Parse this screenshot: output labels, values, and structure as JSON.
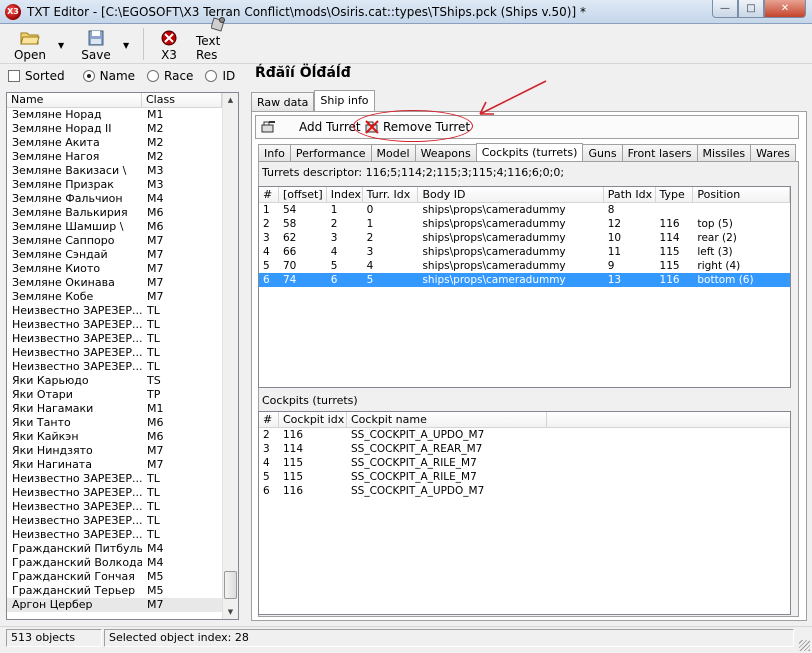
{
  "window": {
    "title": "TXT Editor - [C:\\EGOSOFT\\X3 Terran Conflict\\mods\\Osiris.cat::types\\TShips.pck (Ships v.50)] *",
    "app_icon_text": "X3"
  },
  "toolbar": {
    "open_label": "Open",
    "save_label": "Save",
    "x3_label": "X3",
    "textres_label": "Text Res"
  },
  "filters": {
    "sorted_label": "Sorted",
    "name_label": "Name",
    "race_label": "Race",
    "id_label": "ID",
    "selected": "Name"
  },
  "list": {
    "headers": [
      "Name",
      "Class"
    ],
    "rows": [
      [
        "Земляне Норад",
        "M1"
      ],
      [
        "Земляне Норад II",
        "M2"
      ],
      [
        "Земляне Акита",
        "M2"
      ],
      [
        "Земляне Нагоя",
        "M2"
      ],
      [
        "Земляне Вакизаси \\",
        "M3"
      ],
      [
        "Земляне Призрак",
        "M3"
      ],
      [
        "Земляне Фальчион",
        "M4"
      ],
      [
        "Земляне Валькирия",
        "M6"
      ],
      [
        "Земляне Шамшир \\",
        "M6"
      ],
      [
        "Земляне Саппоро",
        "M7"
      ],
      [
        "Земляне Сэндай",
        "M7"
      ],
      [
        "Земляне Киото",
        "M7"
      ],
      [
        "Земляне Окинава",
        "M7"
      ],
      [
        "Земляне Кобе",
        "M7"
      ],
      [
        "Неизвестно ЗАРЕЗЕР...",
        "TL"
      ],
      [
        "Неизвестно ЗАРЕЗЕР...",
        "TL"
      ],
      [
        "Неизвестно ЗАРЕЗЕР...",
        "TL"
      ],
      [
        "Неизвестно ЗАРЕЗЕР...",
        "TL"
      ],
      [
        "Неизвестно ЗАРЕЗЕР...",
        "TL"
      ],
      [
        "Яки Карьюдо",
        "TS"
      ],
      [
        "Яки Отари",
        "TP"
      ],
      [
        "Яки Нагамаки",
        "M1"
      ],
      [
        "Яки Танто",
        "M6"
      ],
      [
        "Яки Кайкэн",
        "M6"
      ],
      [
        "Яки Ниндзято",
        "M7"
      ],
      [
        "Яки Нагината",
        "M7"
      ],
      [
        "Неизвестно ЗАРЕЗЕР...",
        "TL"
      ],
      [
        "Неизвестно ЗАРЕЗЕР...",
        "TL"
      ],
      [
        "Неизвестно ЗАРЕЗЕР...",
        "TL"
      ],
      [
        "Неизвестно ЗАРЕЗЕР...",
        "TL"
      ],
      [
        "Неизвестно ЗАРЕЗЕР...",
        "TL"
      ],
      [
        "Гражданский Питбуль",
        "M4"
      ],
      [
        "Гражданский Волкодав",
        "M4"
      ],
      [
        "Гражданский Гончая",
        "M5"
      ],
      [
        "Гражданский Терьер",
        "M5"
      ],
      [
        "Аргон Цербер",
        "M7"
      ]
    ]
  },
  "ship_name": "Ŕđăîí Öĺđáĺđ",
  "outer_tabs": [
    "Raw data",
    "Ship info"
  ],
  "turret_bar": {
    "add_label": "Add Turret",
    "remove_label": "Remove Turret"
  },
  "inner_tabs": [
    "Info",
    "Performance",
    "Model",
    "Weapons",
    "Cockpits (turrets)",
    "Guns",
    "Front lasers",
    "Missiles",
    "Wares"
  ],
  "turrets": {
    "descriptor": "Turrets descriptor: 116;5;114;2;115;3;115;4;116;6;0;0;",
    "headers": [
      "#",
      "[offset]",
      "Index",
      "Turr. Idx",
      "Body ID",
      "Path Idx",
      "Type",
      "Position"
    ],
    "rows": [
      [
        "1",
        "54",
        "1",
        "0",
        "ships\\props\\cameradummy",
        "8",
        "",
        ""
      ],
      [
        "2",
        "58",
        "2",
        "1",
        "ships\\props\\cameradummy",
        "12",
        "116",
        "top (5)"
      ],
      [
        "3",
        "62",
        "3",
        "2",
        "ships\\props\\cameradummy",
        "10",
        "114",
        "rear (2)"
      ],
      [
        "4",
        "66",
        "4",
        "3",
        "ships\\props\\cameradummy",
        "11",
        "115",
        "left (3)"
      ],
      [
        "5",
        "70",
        "5",
        "4",
        "ships\\props\\cameradummy",
        "9",
        "115",
        "right (4)"
      ],
      [
        "6",
        "74",
        "6",
        "5",
        "ships\\props\\cameradummy",
        "13",
        "116",
        "bottom (6)"
      ]
    ]
  },
  "cockpits": {
    "label": "Cockpits (turrets)",
    "headers": [
      "#",
      "Cockpit idx",
      "Cockpit name"
    ],
    "rows": [
      [
        "2",
        "116",
        "SS_COCKPIT_A_UPDO_M7"
      ],
      [
        "3",
        "114",
        "SS_COCKPIT_A_REAR_M7"
      ],
      [
        "4",
        "115",
        "SS_COCKPIT_A_RILE_M7"
      ],
      [
        "5",
        "115",
        "SS_COCKPIT_A_RILE_M7"
      ],
      [
        "6",
        "116",
        "SS_COCKPIT_A_UPDO_M7"
      ]
    ]
  },
  "status": {
    "count": "513 objects",
    "selected": "Selected object index: 28"
  },
  "colors": {
    "selection": "#3399ff",
    "callout": "#d4202a"
  }
}
